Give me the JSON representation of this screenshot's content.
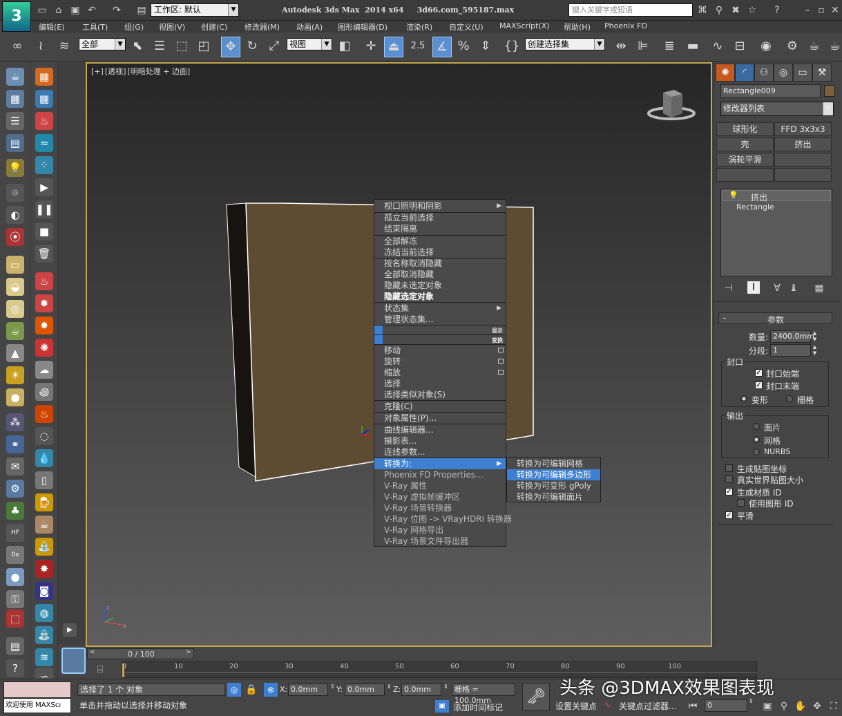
{
  "app": {
    "title": "Autodesk 3ds Max  2014 x64     3d66.com_595187.max",
    "workspace_label": "工作区: 默认",
    "search_placeholder": "键入关键字或短语",
    "logo_text": "3"
  },
  "menu": [
    "编辑(E)",
    "工具(T)",
    "组(G)",
    "视图(V)",
    "创建(C)",
    "修改器(M)",
    "动画(A)",
    "图形编辑器(D)",
    "渲染(R)",
    "自定义(U)",
    "MAXScript(X)",
    "帮助(H)",
    "Phoenix FD"
  ],
  "toolbar": {
    "selection_filter": "全部",
    "coord_system": "视图",
    "snap_value": "2.5",
    "named_selection": "创建选择集"
  },
  "viewport": {
    "label_parts": [
      "[+]",
      "[透视]",
      "[明暗处理 + 边面]"
    ]
  },
  "context_menu": {
    "items": [
      {
        "label": "视口照明和阴影",
        "arrow": true
      },
      {
        "label": "孤立当前选择"
      },
      {
        "label": "结束隔离"
      },
      {
        "label": "全部解冻"
      },
      {
        "label": "冻结当前选择"
      },
      {
        "label": "按名称取消隐藏"
      },
      {
        "label": "全部取消隐藏"
      },
      {
        "label": "隐藏未选定对象"
      },
      {
        "label": "隐藏选定对象"
      },
      {
        "label": "状态集",
        "arrow": true
      },
      {
        "label": "管理状态集..."
      },
      {
        "label": "显示"
      },
      {
        "label": "变换"
      },
      {
        "label": "移动"
      },
      {
        "label": "旋转"
      },
      {
        "label": "缩放"
      },
      {
        "label": "选择"
      },
      {
        "label": "选择类似对象(S)"
      },
      {
        "label": "克隆(C)"
      },
      {
        "label": "对象属性(P)..."
      },
      {
        "label": "曲线编辑器..."
      },
      {
        "label": "摄影表..."
      },
      {
        "label": "连线参数..."
      },
      {
        "label": "转换为:",
        "arrow": true
      },
      {
        "label": "Phoenix FD Properties..."
      },
      {
        "label": "V-Ray 属性"
      },
      {
        "label": "V-Ray 虚拟帧缓冲区"
      },
      {
        "label": "V-Ray 场景转换器"
      },
      {
        "label": "V-Ray 位图 -> VRayHDRI 转换器"
      },
      {
        "label": "V-Ray 网格导出"
      },
      {
        "label": "V-Ray 场景文件导出器"
      }
    ],
    "submenu": [
      "转换为可编辑网格",
      "转换为可编辑多边形",
      "转换为可变形 gPoly",
      "转换为可编辑面片"
    ]
  },
  "panel": {
    "object_name": "Rectangle009",
    "modifier_list": "修改器列表",
    "modifier_buttons": [
      "球形化",
      "FFD 3x3x3",
      "壳",
      "挤出",
      "涡轮平滑",
      "",
      "",
      ""
    ],
    "stack": [
      "挤出",
      "Rectangle"
    ],
    "rollout_title": "参数",
    "amount_label": "数量:",
    "amount_value": "2400.0mm",
    "segments_label": "分段:",
    "segments_value": "1",
    "capping_title": "封口",
    "cap_start": "封口始端",
    "cap_end": "封口末端",
    "morph": "变形",
    "grid": "栅格",
    "output_title": "输出",
    "patch": "面片",
    "mesh": "网格",
    "nurbs": "NURBS",
    "gen_map_coords": "生成贴图坐标",
    "real_world": "真实世界贴图大小",
    "gen_mat_ids": "生成材质 ID",
    "use_shape_ids": "使用图形 ID",
    "smooth": "平滑",
    "collapse_icon": "-"
  },
  "timeline": {
    "frame_display": "0 / 100",
    "ticks": [
      "0",
      "10",
      "20",
      "30",
      "40",
      "50",
      "60",
      "70",
      "80",
      "90",
      "100"
    ]
  },
  "status": {
    "maxscript_label": "欢迎使用 MAXScı",
    "selection_info": "选择了 1 个 对象",
    "prompt": "单击并拖动以选择并移动对象",
    "x_label": "X:",
    "x_value": "0.0mm",
    "y_label": "Y:",
    "y_value": "0.0mm",
    "z_label": "Z:",
    "z_value": "0.0mm",
    "grid_value": "栅格 = 100.0mm",
    "add_time_tag": "添加时间标记",
    "set_key": "设置关键点",
    "key_filters": "关键点过滤器...",
    "frame_field": "0",
    "watermark": "头条 @3DMAX效果图表现"
  },
  "colors": {
    "accent": "#3d7fd1",
    "viewport_border": "#c8a64a",
    "object_front": "#5e4c32",
    "object_side": "#171410"
  }
}
